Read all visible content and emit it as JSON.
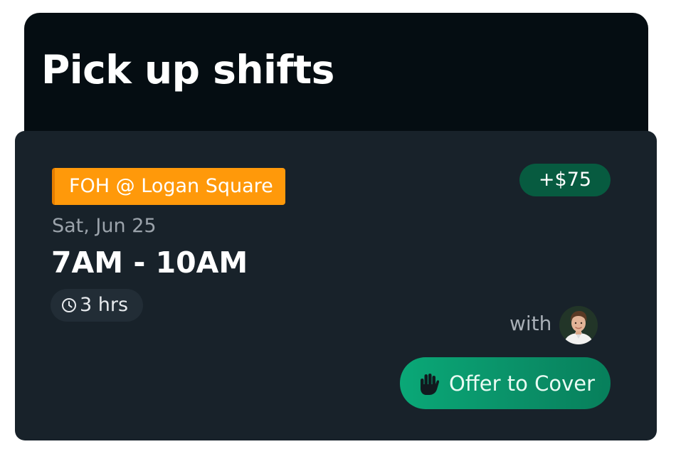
{
  "header": {
    "title": "Pick up shifts"
  },
  "shift": {
    "location": "FOH @ Logan Square",
    "date": "Sat, Jun 25",
    "time_range": "7AM - 10AM",
    "duration": "3 hrs",
    "bonus": "+$75",
    "with_label": "with",
    "offer_button_label": "Offer to Cover"
  },
  "colors": {
    "header_bg": "#050d12",
    "card_bg": "#18222a",
    "location_tag": "#ff990a",
    "bonus_badge": "#075b40",
    "offer_button": "#0a9a6e"
  },
  "icons": {
    "duration": "clock-icon",
    "offer": "raised-hand-icon",
    "coworker": "avatar"
  }
}
